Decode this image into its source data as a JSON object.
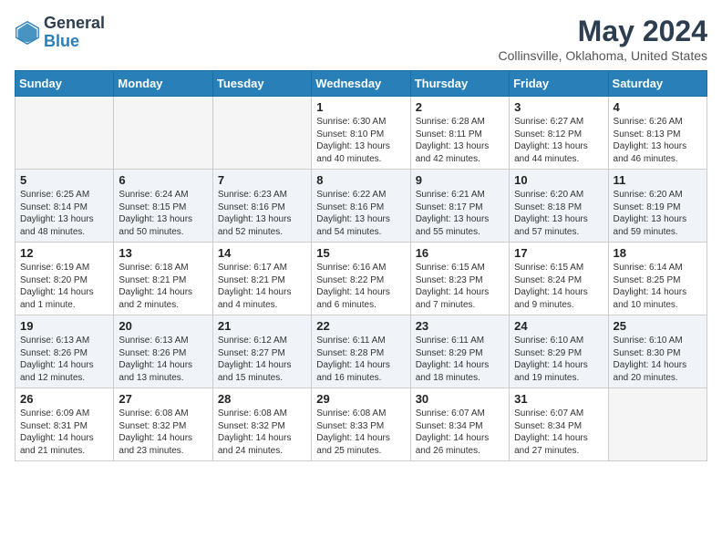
{
  "header": {
    "logo_general": "General",
    "logo_blue": "Blue",
    "month_year": "May 2024",
    "location": "Collinsville, Oklahoma, United States"
  },
  "weekdays": [
    "Sunday",
    "Monday",
    "Tuesday",
    "Wednesday",
    "Thursday",
    "Friday",
    "Saturday"
  ],
  "weeks": [
    [
      {
        "day": "",
        "info": ""
      },
      {
        "day": "",
        "info": ""
      },
      {
        "day": "",
        "info": ""
      },
      {
        "day": "1",
        "info": "Sunrise: 6:30 AM\nSunset: 8:10 PM\nDaylight: 13 hours\nand 40 minutes."
      },
      {
        "day": "2",
        "info": "Sunrise: 6:28 AM\nSunset: 8:11 PM\nDaylight: 13 hours\nand 42 minutes."
      },
      {
        "day": "3",
        "info": "Sunrise: 6:27 AM\nSunset: 8:12 PM\nDaylight: 13 hours\nand 44 minutes."
      },
      {
        "day": "4",
        "info": "Sunrise: 6:26 AM\nSunset: 8:13 PM\nDaylight: 13 hours\nand 46 minutes."
      }
    ],
    [
      {
        "day": "5",
        "info": "Sunrise: 6:25 AM\nSunset: 8:14 PM\nDaylight: 13 hours\nand 48 minutes."
      },
      {
        "day": "6",
        "info": "Sunrise: 6:24 AM\nSunset: 8:15 PM\nDaylight: 13 hours\nand 50 minutes."
      },
      {
        "day": "7",
        "info": "Sunrise: 6:23 AM\nSunset: 8:16 PM\nDaylight: 13 hours\nand 52 minutes."
      },
      {
        "day": "8",
        "info": "Sunrise: 6:22 AM\nSunset: 8:16 PM\nDaylight: 13 hours\nand 54 minutes."
      },
      {
        "day": "9",
        "info": "Sunrise: 6:21 AM\nSunset: 8:17 PM\nDaylight: 13 hours\nand 55 minutes."
      },
      {
        "day": "10",
        "info": "Sunrise: 6:20 AM\nSunset: 8:18 PM\nDaylight: 13 hours\nand 57 minutes."
      },
      {
        "day": "11",
        "info": "Sunrise: 6:20 AM\nSunset: 8:19 PM\nDaylight: 13 hours\nand 59 minutes."
      }
    ],
    [
      {
        "day": "12",
        "info": "Sunrise: 6:19 AM\nSunset: 8:20 PM\nDaylight: 14 hours\nand 1 minute."
      },
      {
        "day": "13",
        "info": "Sunrise: 6:18 AM\nSunset: 8:21 PM\nDaylight: 14 hours\nand 2 minutes."
      },
      {
        "day": "14",
        "info": "Sunrise: 6:17 AM\nSunset: 8:21 PM\nDaylight: 14 hours\nand 4 minutes."
      },
      {
        "day": "15",
        "info": "Sunrise: 6:16 AM\nSunset: 8:22 PM\nDaylight: 14 hours\nand 6 minutes."
      },
      {
        "day": "16",
        "info": "Sunrise: 6:15 AM\nSunset: 8:23 PM\nDaylight: 14 hours\nand 7 minutes."
      },
      {
        "day": "17",
        "info": "Sunrise: 6:15 AM\nSunset: 8:24 PM\nDaylight: 14 hours\nand 9 minutes."
      },
      {
        "day": "18",
        "info": "Sunrise: 6:14 AM\nSunset: 8:25 PM\nDaylight: 14 hours\nand 10 minutes."
      }
    ],
    [
      {
        "day": "19",
        "info": "Sunrise: 6:13 AM\nSunset: 8:26 PM\nDaylight: 14 hours\nand 12 minutes."
      },
      {
        "day": "20",
        "info": "Sunrise: 6:13 AM\nSunset: 8:26 PM\nDaylight: 14 hours\nand 13 minutes."
      },
      {
        "day": "21",
        "info": "Sunrise: 6:12 AM\nSunset: 8:27 PM\nDaylight: 14 hours\nand 15 minutes."
      },
      {
        "day": "22",
        "info": "Sunrise: 6:11 AM\nSunset: 8:28 PM\nDaylight: 14 hours\nand 16 minutes."
      },
      {
        "day": "23",
        "info": "Sunrise: 6:11 AM\nSunset: 8:29 PM\nDaylight: 14 hours\nand 18 minutes."
      },
      {
        "day": "24",
        "info": "Sunrise: 6:10 AM\nSunset: 8:29 PM\nDaylight: 14 hours\nand 19 minutes."
      },
      {
        "day": "25",
        "info": "Sunrise: 6:10 AM\nSunset: 8:30 PM\nDaylight: 14 hours\nand 20 minutes."
      }
    ],
    [
      {
        "day": "26",
        "info": "Sunrise: 6:09 AM\nSunset: 8:31 PM\nDaylight: 14 hours\nand 21 minutes."
      },
      {
        "day": "27",
        "info": "Sunrise: 6:08 AM\nSunset: 8:32 PM\nDaylight: 14 hours\nand 23 minutes."
      },
      {
        "day": "28",
        "info": "Sunrise: 6:08 AM\nSunset: 8:32 PM\nDaylight: 14 hours\nand 24 minutes."
      },
      {
        "day": "29",
        "info": "Sunrise: 6:08 AM\nSunset: 8:33 PM\nDaylight: 14 hours\nand 25 minutes."
      },
      {
        "day": "30",
        "info": "Sunrise: 6:07 AM\nSunset: 8:34 PM\nDaylight: 14 hours\nand 26 minutes."
      },
      {
        "day": "31",
        "info": "Sunrise: 6:07 AM\nSunset: 8:34 PM\nDaylight: 14 hours\nand 27 minutes."
      },
      {
        "day": "",
        "info": ""
      }
    ]
  ]
}
